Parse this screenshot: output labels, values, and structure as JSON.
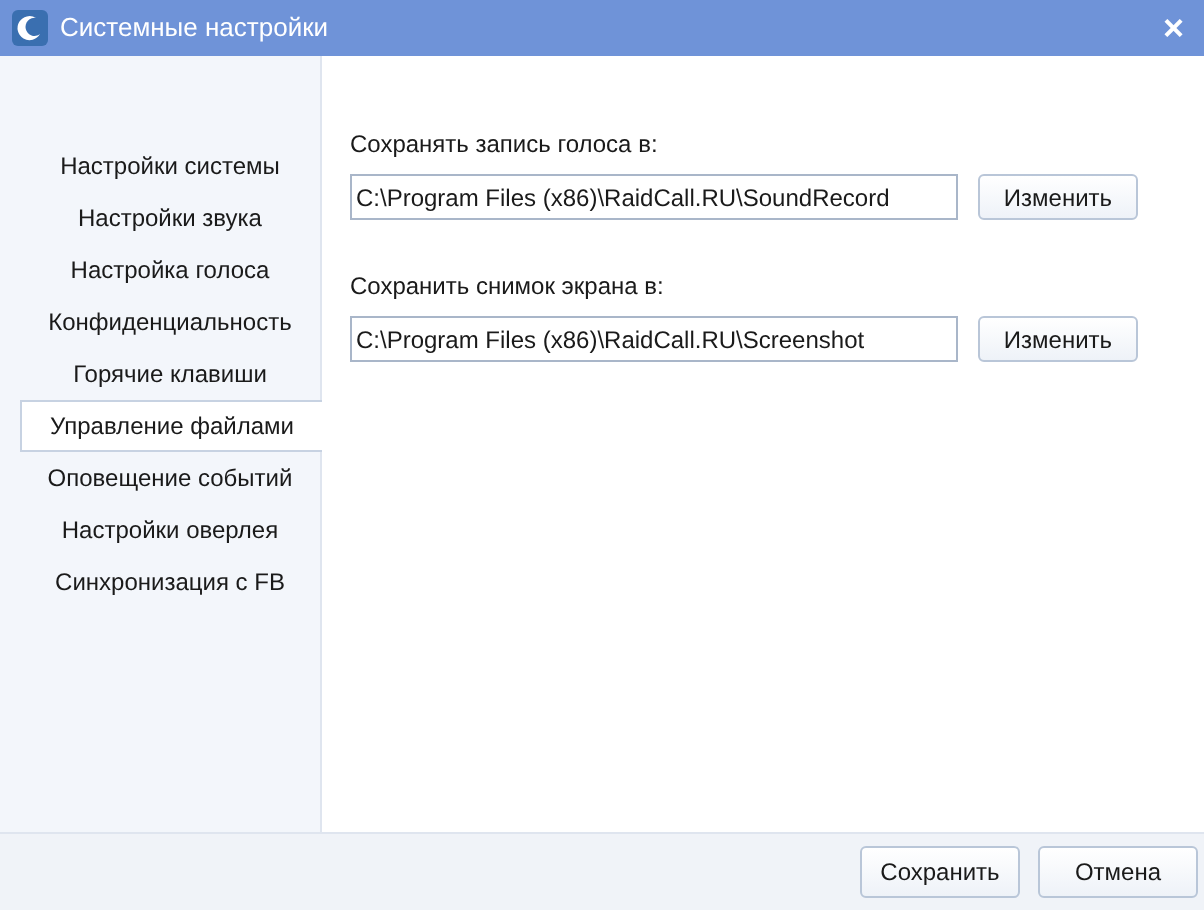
{
  "window": {
    "title": "Системные настройки",
    "close": "×"
  },
  "sidebar": {
    "items": [
      {
        "label": "Настройки системы",
        "selected": false
      },
      {
        "label": "Настройки звука",
        "selected": false
      },
      {
        "label": "Настройка голоса",
        "selected": false
      },
      {
        "label": "Конфиденциальность",
        "selected": false
      },
      {
        "label": "Горячие клавиши",
        "selected": false
      },
      {
        "label": "Управление файлами",
        "selected": true
      },
      {
        "label": "Оповещение событий",
        "selected": false
      },
      {
        "label": "Настройки оверлея",
        "selected": false
      },
      {
        "label": "Синхронизация с FB",
        "selected": false
      }
    ]
  },
  "fields": [
    {
      "label": "Сохранять запись голоса в:",
      "value": "C:\\Program Files (x86)\\RaidCall.RU\\SoundRecord",
      "button": "Изменить"
    },
    {
      "label": "Сохранить снимок экрана в:",
      "value": "C:\\Program Files (x86)\\RaidCall.RU\\Screenshot",
      "button": "Изменить"
    }
  ],
  "buttons": [
    "Сохранить",
    "Отмена"
  ]
}
